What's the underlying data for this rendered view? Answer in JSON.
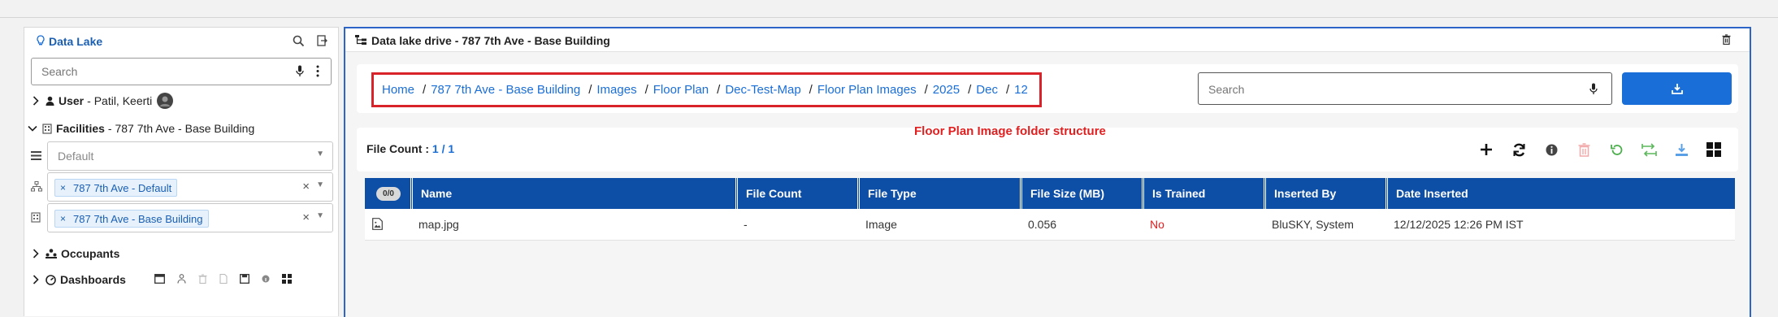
{
  "left": {
    "title": "Data Lake",
    "search_placeholder": "Search",
    "user_label": "User",
    "user_name": "- Patil, Keerti",
    "facilities_label": "Facilities",
    "facilities_name": "- 787 7th Ave - Base Building",
    "select_default_placeholder": "Default",
    "select_site_chip": "787 7th Ave - Default",
    "select_building_chip": "787 7th Ave - Base Building",
    "occupants_label": "Occupants",
    "dashboards_label": "Dashboards"
  },
  "main": {
    "title": "Data lake drive - 787 7th Ave - Base Building",
    "breadcrumb": [
      "Home",
      "787 7th Ave - Base Building",
      "Images",
      "Floor Plan",
      "Dec-Test-Map",
      "Floor Plan Images",
      "2025",
      "Dec",
      "12"
    ],
    "breadcrumb_sep": "/",
    "search_placeholder": "Search",
    "annotation": "Floor Plan Image folder structure",
    "file_count_label": "File Count :",
    "file_count_value": "1 / 1"
  },
  "table": {
    "select_badge": "0/0",
    "columns": [
      "Name",
      "File Count",
      "File Type",
      "File Size (MB)",
      "Is Trained",
      "Inserted By",
      "Date Inserted"
    ],
    "rows": [
      {
        "name": "map.jpg",
        "file_count": "-",
        "file_type": "Image",
        "file_size": "0.056",
        "is_trained": "No",
        "inserted_by": "BluSKY, System",
        "date_inserted": "12/12/2025 12:26 PM IST"
      }
    ]
  },
  "colors": {
    "accent": "#1a6ed8",
    "header_blue": "#0d4ea6",
    "annotation_red": "#e02020",
    "not_trained_red": "#e02020"
  },
  "icons": [
    "bulb-icon",
    "search-icon",
    "logout-icon",
    "mic-icon",
    "kebab-menu-icon",
    "chevron-right-icon",
    "chevron-down-icon",
    "user-icon",
    "building-icon",
    "list-icon",
    "sitemap-icon",
    "close-icon",
    "caret-down-icon",
    "people-icon",
    "dashboard-icon",
    "folder-tree-icon",
    "trash-icon",
    "download-icon",
    "plus-icon",
    "refresh-icon",
    "info-icon",
    "undo-icon",
    "transfer-icon",
    "grid-icon",
    "image-file-icon"
  ]
}
